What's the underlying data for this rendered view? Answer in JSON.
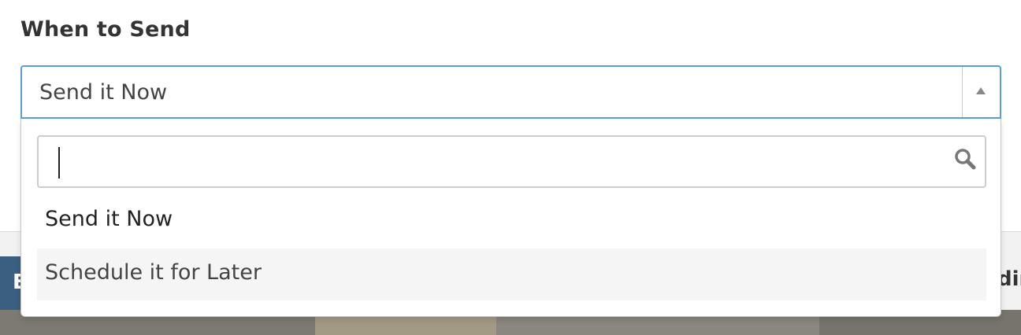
{
  "field": {
    "label": "When to Send",
    "selected_value": "Send it Now"
  },
  "dropdown": {
    "search": {
      "value": "",
      "placeholder": ""
    },
    "options": [
      {
        "label": "Send it Now",
        "highlighted": false
      },
      {
        "label": "Schedule it for Later",
        "highlighted": true
      }
    ]
  },
  "background": {
    "left_button_fragment": "E",
    "right_text_fragment": "din"
  },
  "colors": {
    "focus_border": "#5b9dd9",
    "highlight_row": "#f5f5f5",
    "left_button_bg": "#3a5f80"
  }
}
